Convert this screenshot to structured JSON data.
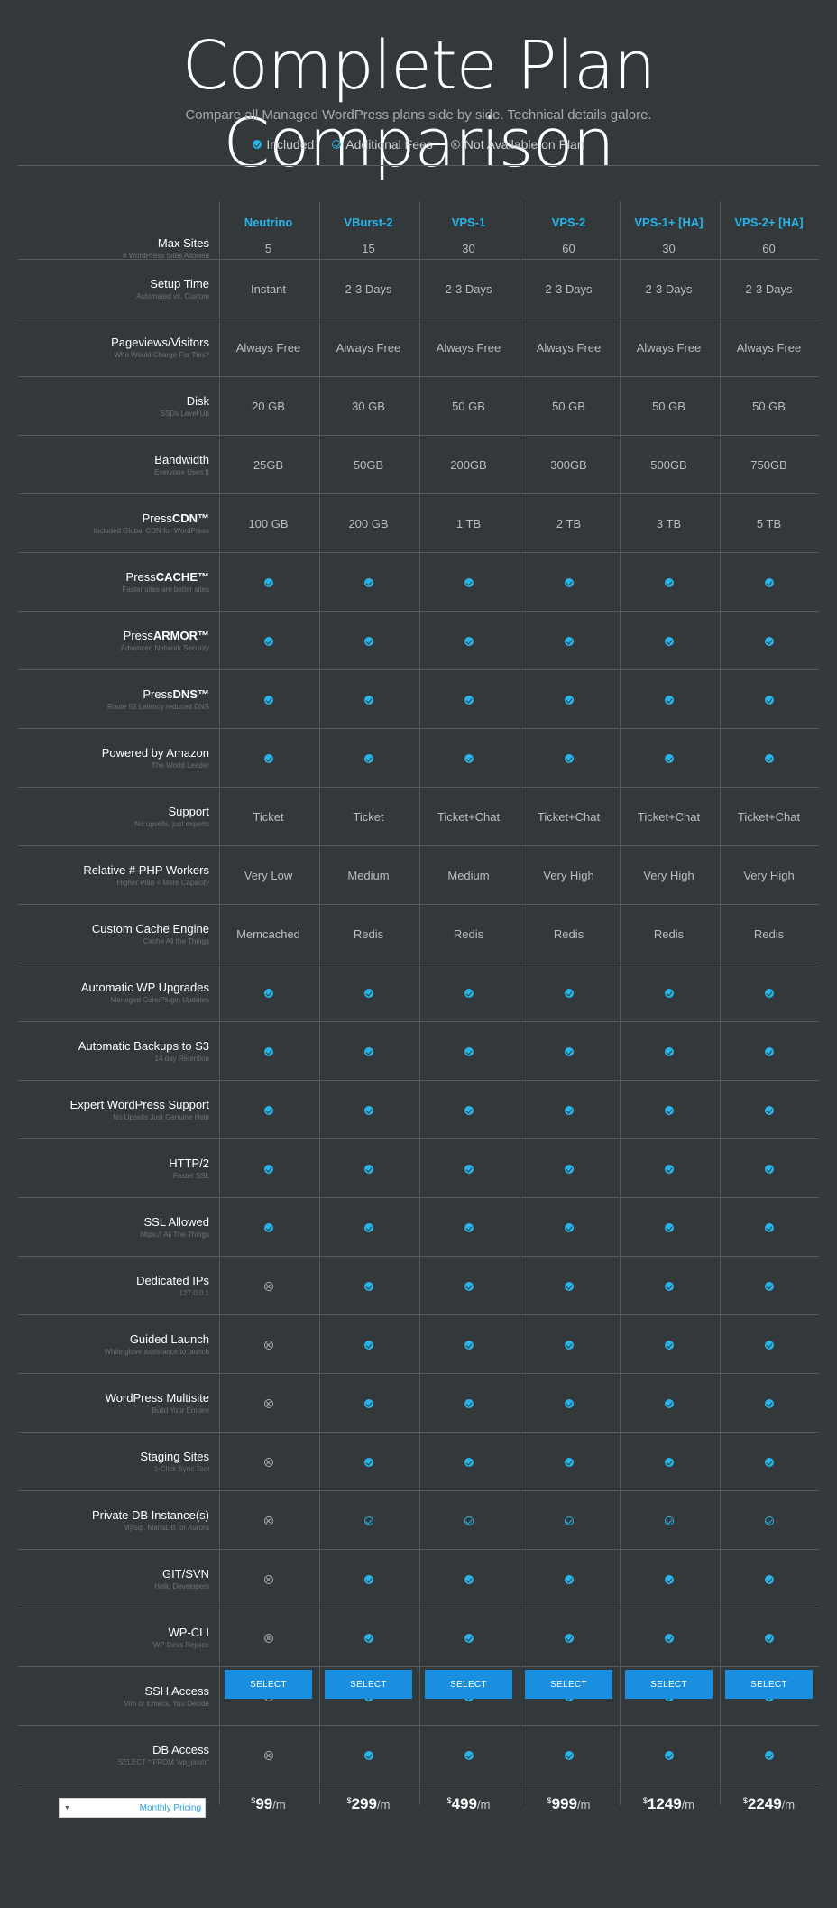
{
  "title": "Complete Plan Comparison",
  "subtitle": "Compare all Managed WordPress plans side by side. Technical details galore.",
  "legend": {
    "included": "Included",
    "additional": "Additional Fees",
    "not_available": "Not Available on Plan"
  },
  "plans": [
    "Neutrino",
    "VBurst-2",
    "VPS-1",
    "VPS-2",
    "VPS-1+ [HA]",
    "VPS-2+ [HA]"
  ],
  "features": [
    {
      "label": "Max Sites",
      "sub": "# WordPress Sites Allowed",
      "values": [
        "5",
        "15",
        "30",
        "60",
        "30",
        "60"
      ]
    },
    {
      "label": "Setup Time",
      "sub": "Automated vs. Custom",
      "values": [
        "Instant",
        "2-3 Days",
        "2-3 Days",
        "2-3 Days",
        "2-3 Days",
        "2-3 Days"
      ]
    },
    {
      "label": "Pageviews/Visitors",
      "sub": "Who Would Charge For This?",
      "values": [
        "Always Free",
        "Always Free",
        "Always Free",
        "Always Free",
        "Always Free",
        "Always Free"
      ]
    },
    {
      "label": "Disk",
      "sub": "SSDs Level Up",
      "values": [
        "20 GB",
        "30 GB",
        "50 GB",
        "50 GB",
        "50 GB",
        "50 GB"
      ]
    },
    {
      "label": "Bandwidth",
      "sub": "Everyone Uses It",
      "values": [
        "25GB",
        "50GB",
        "200GB",
        "300GB",
        "500GB",
        "750GB"
      ]
    },
    {
      "label": "PressCDN™",
      "sub": "Included Global CDN for WordPress",
      "values": [
        "100 GB",
        "200 GB",
        "1 TB",
        "2 TB",
        "3 TB",
        "5 TB"
      ]
    },
    {
      "label": "PressCACHE™",
      "sub": "Faster sites are better sites",
      "values": [
        "included",
        "included",
        "included",
        "included",
        "included",
        "included"
      ]
    },
    {
      "label": "PressARMOR™",
      "sub": "Advanced Network Security",
      "values": [
        "included",
        "included",
        "included",
        "included",
        "included",
        "included"
      ]
    },
    {
      "label": "PressDNS™",
      "sub": "Route 53 Latency reduced DNS",
      "values": [
        "included",
        "included",
        "included",
        "included",
        "included",
        "included"
      ]
    },
    {
      "label": "Powered by Amazon",
      "sub": "The World Leader",
      "values": [
        "included",
        "included",
        "included",
        "included",
        "included",
        "included"
      ]
    },
    {
      "label": "Support",
      "sub": "No upsells, just experts",
      "values": [
        "Ticket",
        "Ticket",
        "Ticket+Chat",
        "Ticket+Chat",
        "Ticket+Chat",
        "Ticket+Chat"
      ]
    },
    {
      "label": "Relative # PHP Workers",
      "sub": "Higher Plan = More Capacity",
      "values": [
        "Very Low",
        "Medium",
        "Medium",
        "Very High",
        "Very High",
        "Very High"
      ]
    },
    {
      "label": "Custom Cache Engine",
      "sub": "Cache All the Things",
      "values": [
        "Memcached",
        "Redis",
        "Redis",
        "Redis",
        "Redis",
        "Redis"
      ]
    },
    {
      "label": "Automatic WP Upgrades",
      "sub": "Managed Core/Plugin Updates",
      "values": [
        "included",
        "included",
        "included",
        "included",
        "included",
        "included"
      ]
    },
    {
      "label": "Automatic Backups to S3",
      "sub": "14 day Retention",
      "values": [
        "included",
        "included",
        "included",
        "included",
        "included",
        "included"
      ]
    },
    {
      "label": "Expert WordPress Support",
      "sub": "No Upsells Just Genuine Help",
      "values": [
        "included",
        "included",
        "included",
        "included",
        "included",
        "included"
      ]
    },
    {
      "label": "HTTP/2",
      "sub": "Faster SSL",
      "values": [
        "included",
        "included",
        "included",
        "included",
        "included",
        "included"
      ]
    },
    {
      "label": "SSL Allowed",
      "sub": "https:// All The Things",
      "values": [
        "included",
        "included",
        "included",
        "included",
        "included",
        "included"
      ]
    },
    {
      "label": "Dedicated IPs",
      "sub": "127.0.0.1",
      "values": [
        "na",
        "included",
        "included",
        "included",
        "included",
        "included"
      ]
    },
    {
      "label": "Guided Launch",
      "sub": "White glove assistance to launch",
      "values": [
        "na",
        "included",
        "included",
        "included",
        "included",
        "included"
      ]
    },
    {
      "label": "WordPress Multisite",
      "sub": "Build Your Empire",
      "values": [
        "na",
        "included",
        "included",
        "included",
        "included",
        "included"
      ]
    },
    {
      "label": "Staging Sites",
      "sub": "1-Click Sync Tool",
      "values": [
        "na",
        "included",
        "included",
        "included",
        "included",
        "included"
      ]
    },
    {
      "label": "Private DB Instance(s)",
      "sub": "MySql, MariaDB, or Aurora",
      "values": [
        "na",
        "fee",
        "fee",
        "fee",
        "fee",
        "fee"
      ]
    },
    {
      "label": "GIT/SVN",
      "sub": "Hello Developers",
      "values": [
        "na",
        "included",
        "included",
        "included",
        "included",
        "included"
      ]
    },
    {
      "label": "WP-CLI",
      "sub": "WP Devs Rejoice",
      "values": [
        "na",
        "included",
        "included",
        "included",
        "included",
        "included"
      ]
    },
    {
      "label": "SSH Access",
      "sub": "Vim or Emacs, You Decide",
      "values": [
        "na",
        "included",
        "included",
        "included",
        "included",
        "included"
      ]
    },
    {
      "label": "DB Access",
      "sub": "SELECT * FROM 'wp_posts'",
      "values": [
        "na",
        "included",
        "included",
        "included",
        "included",
        "included"
      ]
    }
  ],
  "pricing": {
    "selector_value": "Monthly Pricing",
    "currency": "$",
    "per": "/m",
    "prices": [
      "99",
      "299",
      "499",
      "999",
      "1249",
      "2249"
    ]
  },
  "select_label": "SELECT",
  "colors": {
    "background": "#33383b",
    "accent": "#27b4e8",
    "button": "#1b8fdf",
    "grid_line": "#54595d"
  }
}
